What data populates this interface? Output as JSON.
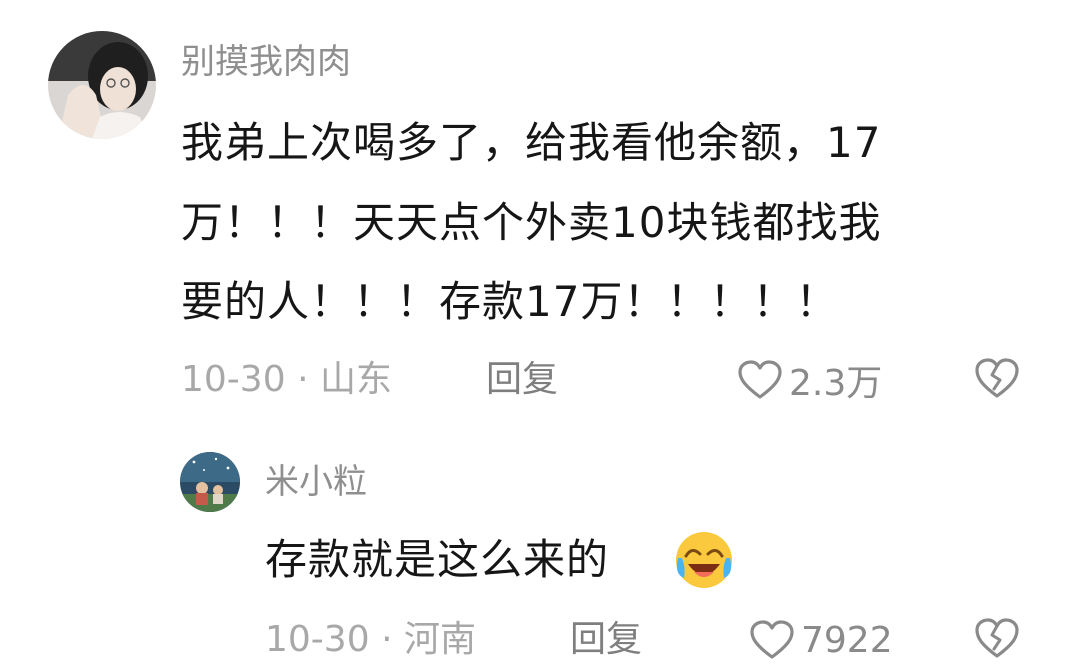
{
  "comments": [
    {
      "username": "别摸我肉肉",
      "text_lines": [
        "我弟上次喝多了，给我看他余额，17",
        "万！！！天天点个外卖10块钱都找我",
        "要的人！！！存款17万！！！！！"
      ],
      "date": "10-30",
      "separator": "·",
      "location": "山东",
      "reply_label": "回复",
      "likes": "2.3万",
      "avatar_icon": "user-avatar-photo-icon",
      "like_icon": "heart-outline-icon",
      "dislike_icon": "broken-heart-icon"
    },
    {
      "username": "米小粒",
      "text": "存款就是这么来的",
      "emoji": "laughing-crying-emoji-icon",
      "date": "10-30",
      "separator": "·",
      "location": "河南",
      "reply_label": "回复",
      "likes": "7922",
      "avatar_icon": "user-avatar-photo-icon",
      "like_icon": "heart-outline-icon",
      "dislike_icon": "broken-heart-icon"
    }
  ],
  "colors": {
    "username": "#8f8f8f",
    "text": "#161616",
    "meta": "#a8a8a8",
    "reply": "#7f7f7f",
    "icon": "#8a8a8a"
  }
}
